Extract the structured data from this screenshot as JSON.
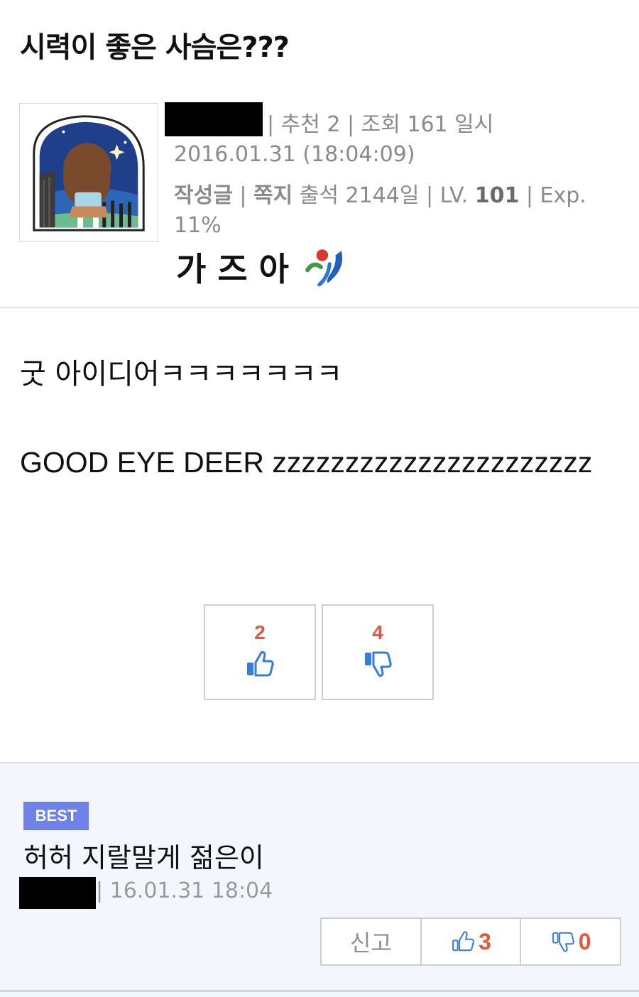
{
  "post": {
    "title": "시력이 좋은 사슴은???",
    "meta": {
      "line1": "| 추천 2 | 조회 161 일시",
      "datetime": "2016.01.31 (18:04:09)",
      "posts_link": "작성글",
      "sep1": " | ",
      "message_link": "쪽지",
      "attendance": " 출석 2144일 |  LV. ",
      "level": "101",
      "exp_label": "  | Exp.",
      "exp_value": "11%"
    },
    "signature_text": "가즈아",
    "body": {
      "line1": "굿 아이디어ㅋㅋㅋㅋㅋㅋㅋ",
      "line2": "GOOD EYE DEER zzzzzzzzzzzzzzzzzzzzzz"
    },
    "votes": {
      "up": "2",
      "down": "4"
    }
  },
  "best_comment": {
    "badge": "BEST",
    "text": "허허 지랄말게 젊은이",
    "date": "| 16.01.31 18:04",
    "report_label": "신고",
    "up": "3",
    "down": "0"
  },
  "colors": {
    "vote_count": "#e2583e",
    "thumb_icon": "#3a7bd5",
    "best_badge": "#6e82e8",
    "comment_bg": "#f3f6fc"
  },
  "icons": {
    "up": "thumbs-up-icon",
    "down": "thumbs-down-icon"
  }
}
